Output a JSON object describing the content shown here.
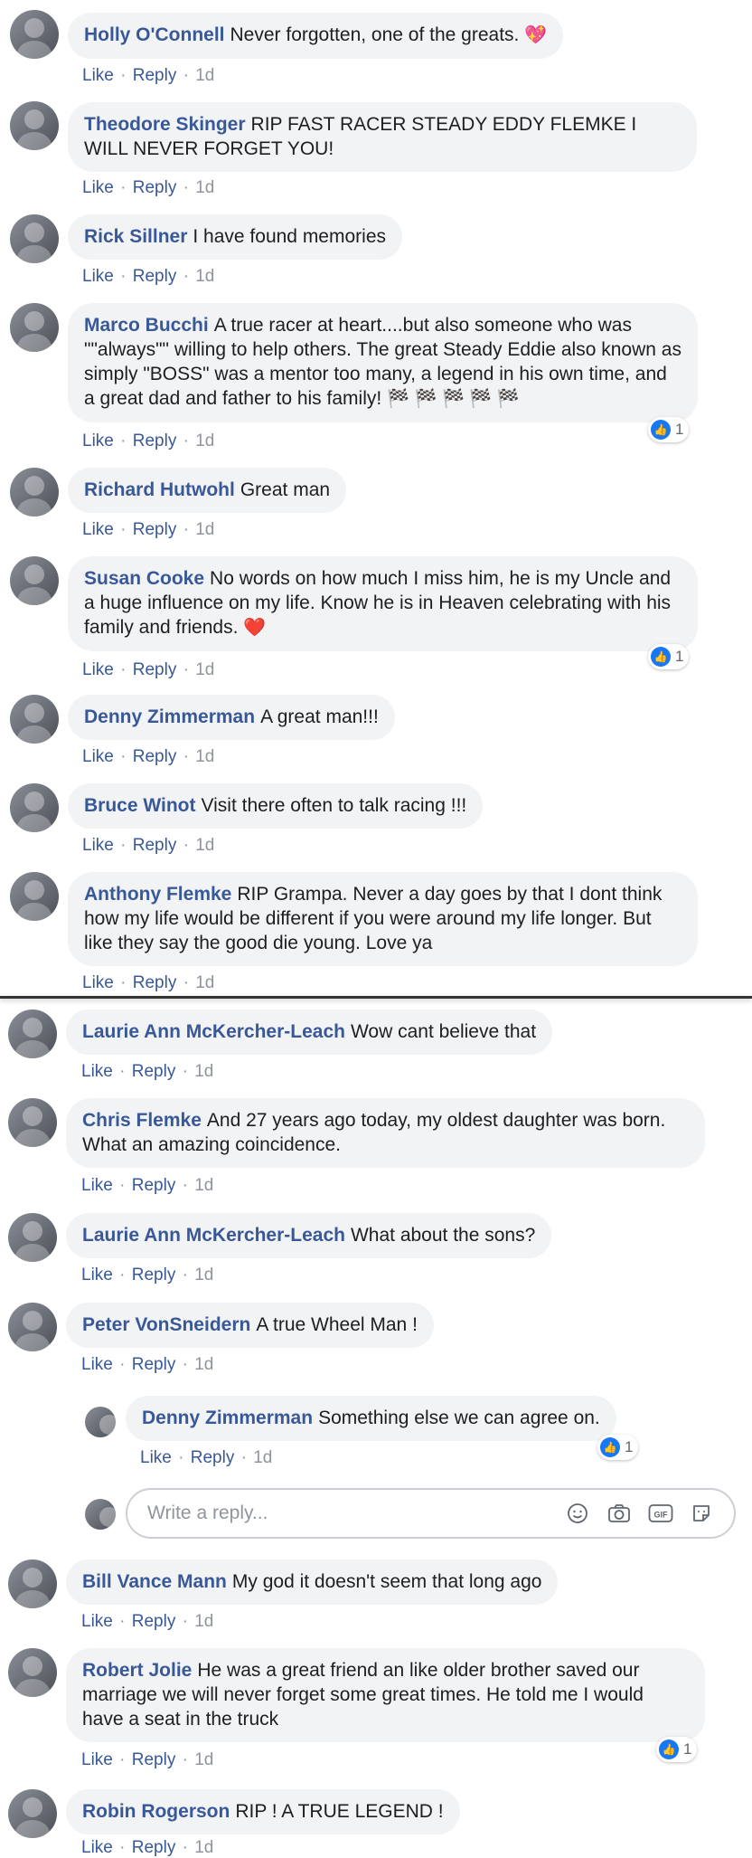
{
  "actions": {
    "like": "Like",
    "reply": "Reply",
    "sep": "·"
  },
  "comments": [
    {
      "author": "Holly O'Connell",
      "text": "Never forgotten, one of the greats.",
      "emoji": "💖",
      "time": "1d"
    },
    {
      "author": "Theodore Skinger",
      "text": "RIP FAST RACER STEADY EDDY FLEMKE I WILL NEVER FORGET YOU!",
      "time": "1d"
    },
    {
      "author": "Rick Sillner",
      "text": "I have found memories",
      "time": "1d"
    },
    {
      "author": "Marco Bucchi",
      "text": "A true racer at heart....but also someone who was \"\"always\"\" willing to help others. The great Steady Eddie also known as simply \"BOSS\" was a mentor too many, a legend in his own time, and a great dad and father to his family!",
      "emoji": "🏁 🏁 🏁 🏁 🏁",
      "time": "1d",
      "reactions": "1"
    },
    {
      "author": "Richard Hutwohl",
      "text": "Great man",
      "time": "1d"
    },
    {
      "author": "Susan Cooke",
      "text": "No words on how much I miss him, he is my Uncle and a huge influence on my life. Know he is in Heaven celebrating with his family and friends.",
      "emoji": "❤️",
      "time": "1d",
      "reactions": "1"
    },
    {
      "author": "Denny Zimmerman",
      "text": "A great man!!!",
      "time": "1d"
    },
    {
      "author": "Bruce Winot",
      "text": "Visit there often to talk racing !!!",
      "time": "1d"
    },
    {
      "author": "Anthony Flemke",
      "text": "RIP Grampa. Never a day goes by that I dont think how my life would be different if you were around my life longer. But like they say the good die young. Love ya",
      "time": "1d"
    },
    {
      "author": "Laurie Ann McKercher-Leach",
      "text": "Wow cant believe that",
      "time": "1d"
    },
    {
      "author": "Chris Flemke",
      "text": "And 27 years ago today, my oldest daughter was born. What an amazing coincidence.",
      "time": "1d"
    },
    {
      "author": "Laurie Ann McKercher-Leach",
      "text": "What about the sons?",
      "time": "1d"
    },
    {
      "author": "Peter VonSneidern",
      "text": "A true Wheel Man !",
      "time": "1d"
    },
    {
      "author": "Denny Zimmerman",
      "text": "Something else we can agree on.",
      "time": "1d",
      "reactions": "1"
    },
    {
      "author": "Bill Vance Mann",
      "text": "My god it doesn't seem that long ago",
      "time": "1d"
    },
    {
      "author": "Robert Jolie",
      "text": "He was a great friend an like older brother saved our marriage we will never forget some great times. He told me I would have a seat in the truck",
      "time": "1d",
      "reactions": "1"
    },
    {
      "author": "Robin Rogerson",
      "text": "RIP ! A TRUE LEGEND !",
      "time": "1d"
    }
  ],
  "reply_box": {
    "placeholder": "Write a reply...",
    "icons": [
      "smiley-icon",
      "camera-icon",
      "gif-icon",
      "sticker-icon"
    ],
    "gif_label": "GIF"
  },
  "colors": {
    "link": "#385898",
    "bubble": "#f2f3f5",
    "like_blue": "#1877f2",
    "muted": "#90949c"
  }
}
